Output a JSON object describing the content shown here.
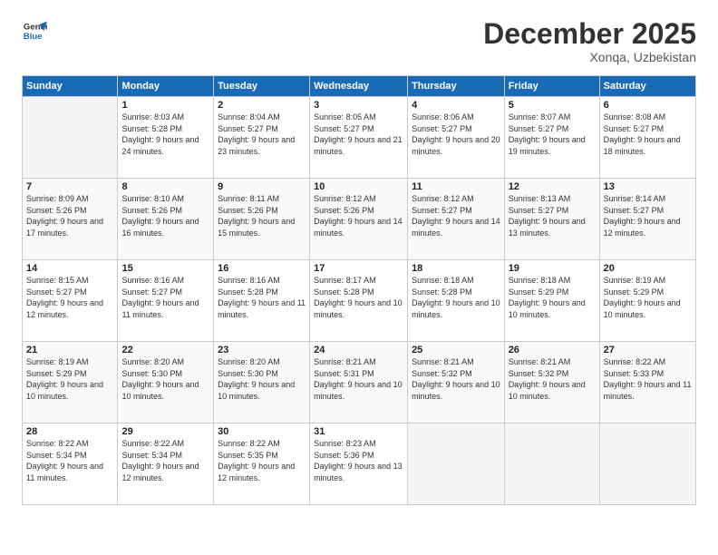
{
  "logo": {
    "line1": "General",
    "line2": "Blue"
  },
  "title": "December 2025",
  "subtitle": "Xonqa, Uzbekistan",
  "header": {
    "days": [
      "Sunday",
      "Monday",
      "Tuesday",
      "Wednesday",
      "Thursday",
      "Friday",
      "Saturday"
    ]
  },
  "weeks": [
    [
      {
        "day": "",
        "sunrise": "",
        "sunset": "",
        "daylight": ""
      },
      {
        "day": "1",
        "sunrise": "Sunrise: 8:03 AM",
        "sunset": "Sunset: 5:28 PM",
        "daylight": "Daylight: 9 hours and 24 minutes."
      },
      {
        "day": "2",
        "sunrise": "Sunrise: 8:04 AM",
        "sunset": "Sunset: 5:27 PM",
        "daylight": "Daylight: 9 hours and 23 minutes."
      },
      {
        "day": "3",
        "sunrise": "Sunrise: 8:05 AM",
        "sunset": "Sunset: 5:27 PM",
        "daylight": "Daylight: 9 hours and 21 minutes."
      },
      {
        "day": "4",
        "sunrise": "Sunrise: 8:06 AM",
        "sunset": "Sunset: 5:27 PM",
        "daylight": "Daylight: 9 hours and 20 minutes."
      },
      {
        "day": "5",
        "sunrise": "Sunrise: 8:07 AM",
        "sunset": "Sunset: 5:27 PM",
        "daylight": "Daylight: 9 hours and 19 minutes."
      },
      {
        "day": "6",
        "sunrise": "Sunrise: 8:08 AM",
        "sunset": "Sunset: 5:27 PM",
        "daylight": "Daylight: 9 hours and 18 minutes."
      }
    ],
    [
      {
        "day": "7",
        "sunrise": "Sunrise: 8:09 AM",
        "sunset": "Sunset: 5:26 PM",
        "daylight": "Daylight: 9 hours and 17 minutes."
      },
      {
        "day": "8",
        "sunrise": "Sunrise: 8:10 AM",
        "sunset": "Sunset: 5:26 PM",
        "daylight": "Daylight: 9 hours and 16 minutes."
      },
      {
        "day": "9",
        "sunrise": "Sunrise: 8:11 AM",
        "sunset": "Sunset: 5:26 PM",
        "daylight": "Daylight: 9 hours and 15 minutes."
      },
      {
        "day": "10",
        "sunrise": "Sunrise: 8:12 AM",
        "sunset": "Sunset: 5:26 PM",
        "daylight": "Daylight: 9 hours and 14 minutes."
      },
      {
        "day": "11",
        "sunrise": "Sunrise: 8:12 AM",
        "sunset": "Sunset: 5:27 PM",
        "daylight": "Daylight: 9 hours and 14 minutes."
      },
      {
        "day": "12",
        "sunrise": "Sunrise: 8:13 AM",
        "sunset": "Sunset: 5:27 PM",
        "daylight": "Daylight: 9 hours and 13 minutes."
      },
      {
        "day": "13",
        "sunrise": "Sunrise: 8:14 AM",
        "sunset": "Sunset: 5:27 PM",
        "daylight": "Daylight: 9 hours and 12 minutes."
      }
    ],
    [
      {
        "day": "14",
        "sunrise": "Sunrise: 8:15 AM",
        "sunset": "Sunset: 5:27 PM",
        "daylight": "Daylight: 9 hours and 12 minutes."
      },
      {
        "day": "15",
        "sunrise": "Sunrise: 8:16 AM",
        "sunset": "Sunset: 5:27 PM",
        "daylight": "Daylight: 9 hours and 11 minutes."
      },
      {
        "day": "16",
        "sunrise": "Sunrise: 8:16 AM",
        "sunset": "Sunset: 5:28 PM",
        "daylight": "Daylight: 9 hours and 11 minutes."
      },
      {
        "day": "17",
        "sunrise": "Sunrise: 8:17 AM",
        "sunset": "Sunset: 5:28 PM",
        "daylight": "Daylight: 9 hours and 10 minutes."
      },
      {
        "day": "18",
        "sunrise": "Sunrise: 8:18 AM",
        "sunset": "Sunset: 5:28 PM",
        "daylight": "Daylight: 9 hours and 10 minutes."
      },
      {
        "day": "19",
        "sunrise": "Sunrise: 8:18 AM",
        "sunset": "Sunset: 5:29 PM",
        "daylight": "Daylight: 9 hours and 10 minutes."
      },
      {
        "day": "20",
        "sunrise": "Sunrise: 8:19 AM",
        "sunset": "Sunset: 5:29 PM",
        "daylight": "Daylight: 9 hours and 10 minutes."
      }
    ],
    [
      {
        "day": "21",
        "sunrise": "Sunrise: 8:19 AM",
        "sunset": "Sunset: 5:29 PM",
        "daylight": "Daylight: 9 hours and 10 minutes."
      },
      {
        "day": "22",
        "sunrise": "Sunrise: 8:20 AM",
        "sunset": "Sunset: 5:30 PM",
        "daylight": "Daylight: 9 hours and 10 minutes."
      },
      {
        "day": "23",
        "sunrise": "Sunrise: 8:20 AM",
        "sunset": "Sunset: 5:30 PM",
        "daylight": "Daylight: 9 hours and 10 minutes."
      },
      {
        "day": "24",
        "sunrise": "Sunrise: 8:21 AM",
        "sunset": "Sunset: 5:31 PM",
        "daylight": "Daylight: 9 hours and 10 minutes."
      },
      {
        "day": "25",
        "sunrise": "Sunrise: 8:21 AM",
        "sunset": "Sunset: 5:32 PM",
        "daylight": "Daylight: 9 hours and 10 minutes."
      },
      {
        "day": "26",
        "sunrise": "Sunrise: 8:21 AM",
        "sunset": "Sunset: 5:32 PM",
        "daylight": "Daylight: 9 hours and 10 minutes."
      },
      {
        "day": "27",
        "sunrise": "Sunrise: 8:22 AM",
        "sunset": "Sunset: 5:33 PM",
        "daylight": "Daylight: 9 hours and 11 minutes."
      }
    ],
    [
      {
        "day": "28",
        "sunrise": "Sunrise: 8:22 AM",
        "sunset": "Sunset: 5:34 PM",
        "daylight": "Daylight: 9 hours and 11 minutes."
      },
      {
        "day": "29",
        "sunrise": "Sunrise: 8:22 AM",
        "sunset": "Sunset: 5:34 PM",
        "daylight": "Daylight: 9 hours and 12 minutes."
      },
      {
        "day": "30",
        "sunrise": "Sunrise: 8:22 AM",
        "sunset": "Sunset: 5:35 PM",
        "daylight": "Daylight: 9 hours and 12 minutes."
      },
      {
        "day": "31",
        "sunrise": "Sunrise: 8:23 AM",
        "sunset": "Sunset: 5:36 PM",
        "daylight": "Daylight: 9 hours and 13 minutes."
      },
      {
        "day": "",
        "sunrise": "",
        "sunset": "",
        "daylight": ""
      },
      {
        "day": "",
        "sunrise": "",
        "sunset": "",
        "daylight": ""
      },
      {
        "day": "",
        "sunrise": "",
        "sunset": "",
        "daylight": ""
      }
    ]
  ]
}
